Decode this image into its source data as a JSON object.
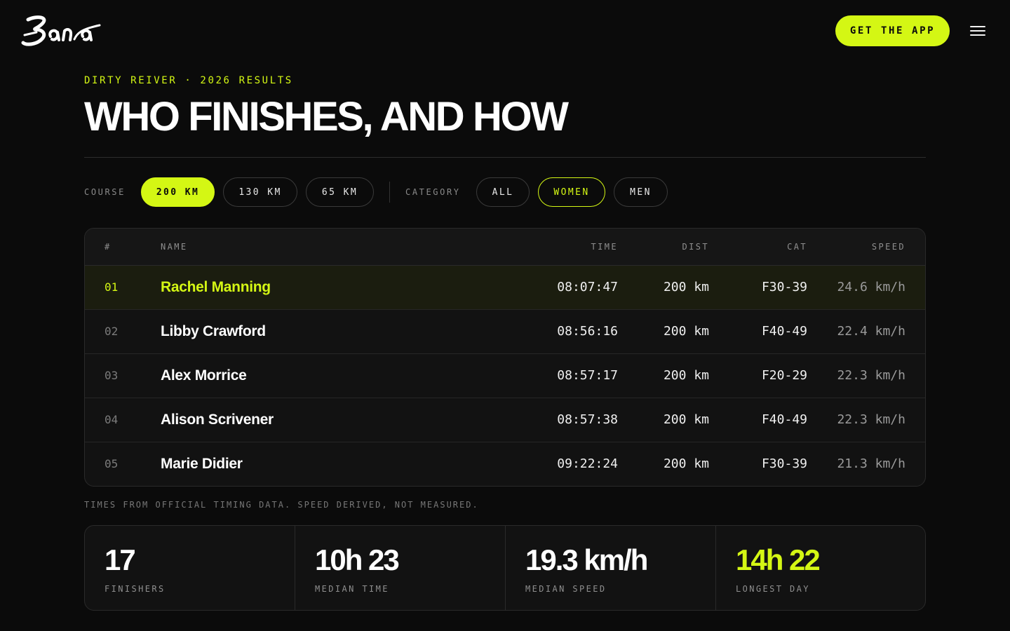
{
  "header": {
    "logo_text": "Bana",
    "cta_label": "GET THE APP",
    "menu_icon": "hamburger-icon"
  },
  "hero": {
    "eyebrow": "DIRTY REIVER · 2026 RESULTS",
    "title": "WHO FINISHES, AND HOW"
  },
  "filters": {
    "course_label": "COURSE",
    "courses": [
      {
        "label": "200 KM",
        "selected": true
      },
      {
        "label": "130 KM",
        "selected": false
      },
      {
        "label": "65 KM",
        "selected": false
      }
    ],
    "category_label": "CATEGORY",
    "categories": [
      {
        "label": "ALL",
        "selected": false
      },
      {
        "label": "WOMEN",
        "selected": true
      },
      {
        "label": "MEN",
        "selected": false
      }
    ]
  },
  "table": {
    "columns": [
      "#",
      "NAME",
      "TIME",
      "DIST",
      "CAT",
      "SPEED"
    ],
    "rows": [
      {
        "rank": "01",
        "name": "Rachel Manning",
        "time": "08:07:47",
        "dist": "200 km",
        "cat": "F30-39",
        "speed": "24.6 km/h",
        "highlight": true
      },
      {
        "rank": "02",
        "name": "Libby Crawford",
        "time": "08:56:16",
        "dist": "200 km",
        "cat": "F40-49",
        "speed": "22.4 km/h"
      },
      {
        "rank": "03",
        "name": "Alex Morrice",
        "time": "08:57:17",
        "dist": "200 km",
        "cat": "F20-29",
        "speed": "22.3 km/h"
      },
      {
        "rank": "04",
        "name": "Alison Scrivener",
        "time": "08:57:38",
        "dist": "200 km",
        "cat": "F40-49",
        "speed": "22.3 km/h"
      },
      {
        "rank": "05",
        "name": "Marie Didier",
        "time": "09:22:24",
        "dist": "200 km",
        "cat": "F30-39",
        "speed": "21.3 km/h"
      }
    ]
  },
  "footnote": "TIMES FROM OFFICIAL TIMING DATA. SPEED DERIVED, NOT MEASURED.",
  "stats": [
    {
      "value": "17",
      "label": "FINISHERS"
    },
    {
      "value": "10h 23",
      "label": "MEDIAN TIME"
    },
    {
      "value": "19.3 km/h",
      "label": "MEDIAN SPEED"
    },
    {
      "value": "14h 22",
      "label": "LONGEST DAY",
      "accent": true
    }
  ],
  "colors": {
    "accent": "#d4f714",
    "background": "#0b0b0b",
    "panel": "#121212"
  }
}
